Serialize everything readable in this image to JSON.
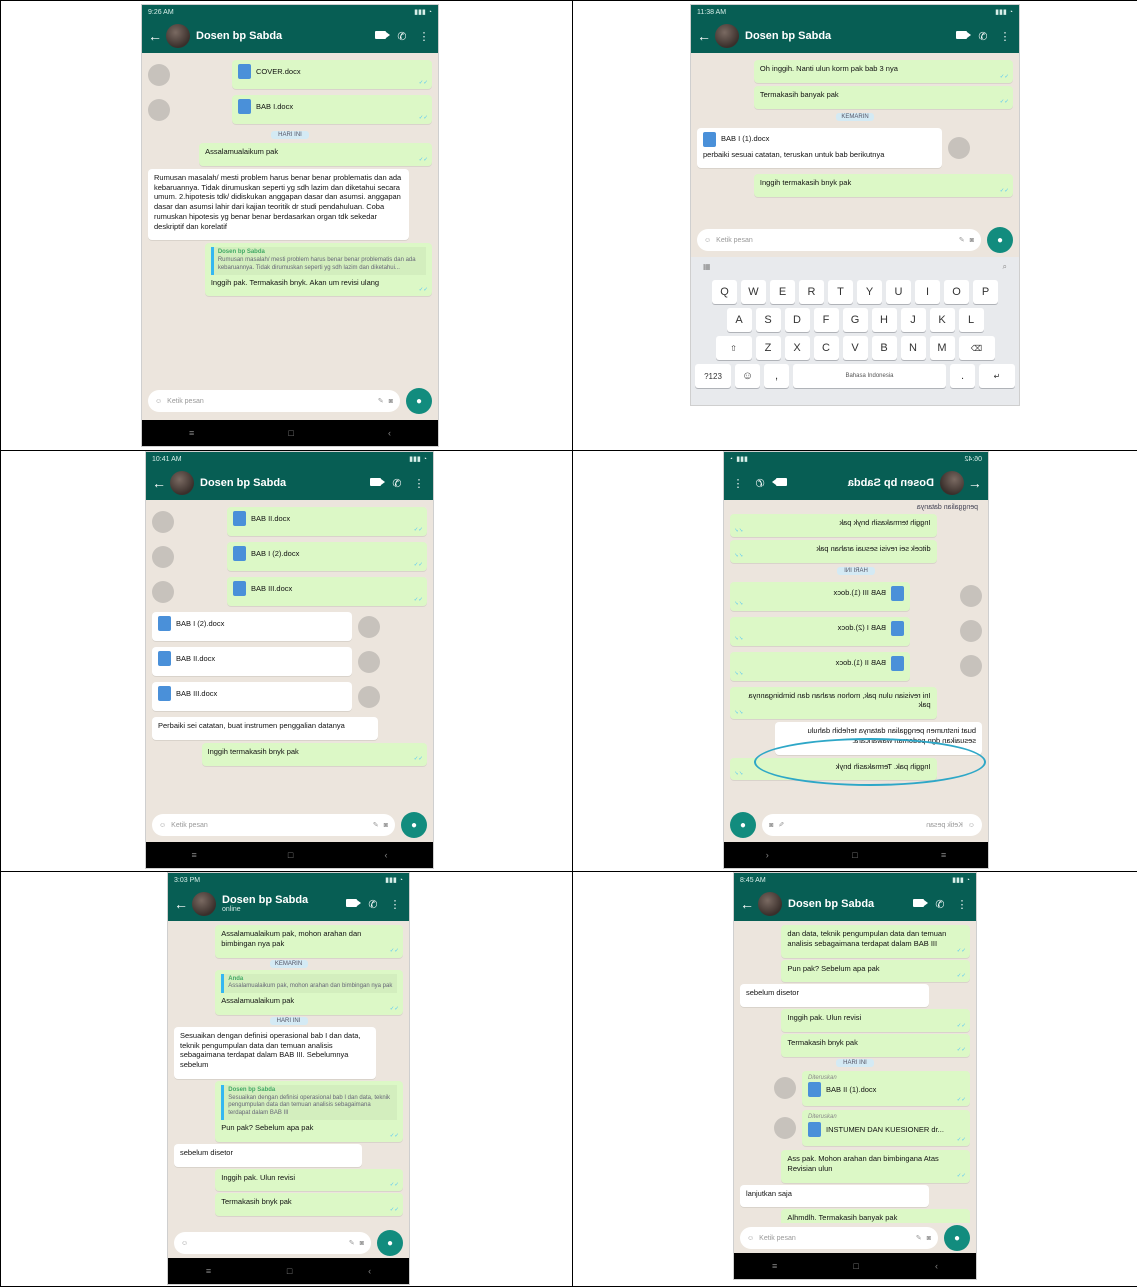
{
  "contact": "Dosen bp Sabda",
  "status_online": "online",
  "input_placeholder": "Ketik pesan",
  "times": {
    "p1": "9:26 AM",
    "p2": "11:38 AM",
    "p3": "10:41 AM",
    "p4": "06:42",
    "p5": "3:03 PM",
    "p6": "8:45 AM"
  },
  "p1": {
    "files": [
      "COVER.docx",
      "BAB I.docx"
    ],
    "date": "HARI INI",
    "m1": "Assalamualaikum pak",
    "m2": "Rumusan masalah/ mesti problem harus benar benar problematis dan ada kebaruannya. Tidak dirumuskan seperti yg sdh lazim dan diketahui secara umum. 2.hipotesis tdk/ didiskukan anggapan dasar dan asumsi. anggapan dasar dan asumsi lahir dari kajian teoritik dr studi pendahuluan. Coba rumuskan hipotesis yg benar benar berdasarkan organ tdk sekedar deskriptif dan korelatif",
    "q_name": "Dosen bp Sabda",
    "q_text": "Rumusan masalah/ mesti problem harus benar benar problematis dan ada kebaruannya. Tidak dirumuskan seperti yg sdh lazim dan diketahui...",
    "m3": "Inggih pak. Termakasih bnyk. Akan um revisi ulang"
  },
  "p2": {
    "m1": "Oh inggih. Nanti ulun korm pak bab 3 nya",
    "m2": "Termakasih banyak pak",
    "date": "KEMARIN",
    "file": "BAB I (1).docx",
    "m3": "perbaiki sesuai catatan, teruskan untuk bab berikutnya",
    "m4": "Inggih termakasih bnyk pak",
    "kb_rows": [
      [
        "Q",
        "W",
        "E",
        "R",
        "T",
        "Y",
        "U",
        "I",
        "O",
        "P"
      ],
      [
        "A",
        "S",
        "D",
        "F",
        "G",
        "H",
        "J",
        "K",
        "L"
      ],
      [
        "Z",
        "X",
        "C",
        "V",
        "B",
        "N",
        "M"
      ]
    ],
    "k_shift": "⇧",
    "k_del": "⌫",
    "k_num": "?123",
    "k_space": "Bahasa Indonesia",
    "k_enter": "↵"
  },
  "p3": {
    "out_files": [
      "BAB II.docx",
      "BAB I (2).docx",
      "BAB III.docx"
    ],
    "in_files": [
      "BAB I (2).docx",
      "BAB II.docx",
      "BAB III.docx"
    ],
    "m1": "Perbaiki sei catatan, buat instrumen penggalian datanya",
    "m2": "Inggih termakasih bnyk pak"
  },
  "p4": {
    "m0": "penggalian datanya",
    "m1": "Inggih termakasih bnyk pak",
    "m2": "ditcek sei revisi sesuai arahan pak",
    "date": "HARI INI",
    "files": [
      "BAB III (1).docx",
      "BAB I (2).docx",
      "BAB II (1).docx"
    ],
    "m3": "Ini revisian ulun pak, mohon arahan dan bimbingannya pak",
    "m4": "buat instrumen penggalian datanya terlebih dahulu sesuaikan dgn pedoman wawancara.",
    "m5": "Inggih pak. Termakasih bnyk"
  },
  "p5": {
    "m1": "Assalamualaikum pak, mohon arahan dan bimbingan nya pak",
    "date": "KEMARIN",
    "q1_name": "Anda",
    "q1_text": "Assalamualaikum pak, mohon arahan dan bimbingan nya pak",
    "m2": "Assalamualaikum pak",
    "date2": "HARI INI",
    "m3": "Sesuaikan dengan definisi operasional bab I dan data, teknik pengumpulan data dan temuan analisis sebagaimana terdapat dalam BAB III. Sebelumnya sebelum",
    "q2_name": "Dosen bp Sabda",
    "q2_text": "Sesuaikan dengan definisi operasional bab I dan data, teknik pengumpulan data dan temuan analisis sebagaimana terdapat dalam BAB III",
    "m4": "Pun pak? Sebelum apa pak",
    "m5": "sebelum disetor",
    "m6": "Inggih pak. Ulun revisi",
    "m7": "Termakasih bnyk pak"
  },
  "p6": {
    "m0": "dan data, teknik pengumpulan data dan temuan analisis sebagaimana terdapat dalam BAB III",
    "m1": "Pun pak? Sebelum apa pak",
    "m2": "sebelum disetor",
    "m3": "Inggih pak. Ulun revisi",
    "m4": "Termakasih bnyk pak",
    "date": "HARI INI",
    "fwd": "Diteruskan",
    "files": [
      "BAB II (1).docx",
      "INSTUMEN DAN KUESIONER dr..."
    ],
    "m5": "Ass pak. Mohon arahan dan bimbingana Atas Revisian ulun",
    "m6": "lanjutkan saja",
    "m7": "Alhmdlh. Termakasih banyak pak"
  }
}
